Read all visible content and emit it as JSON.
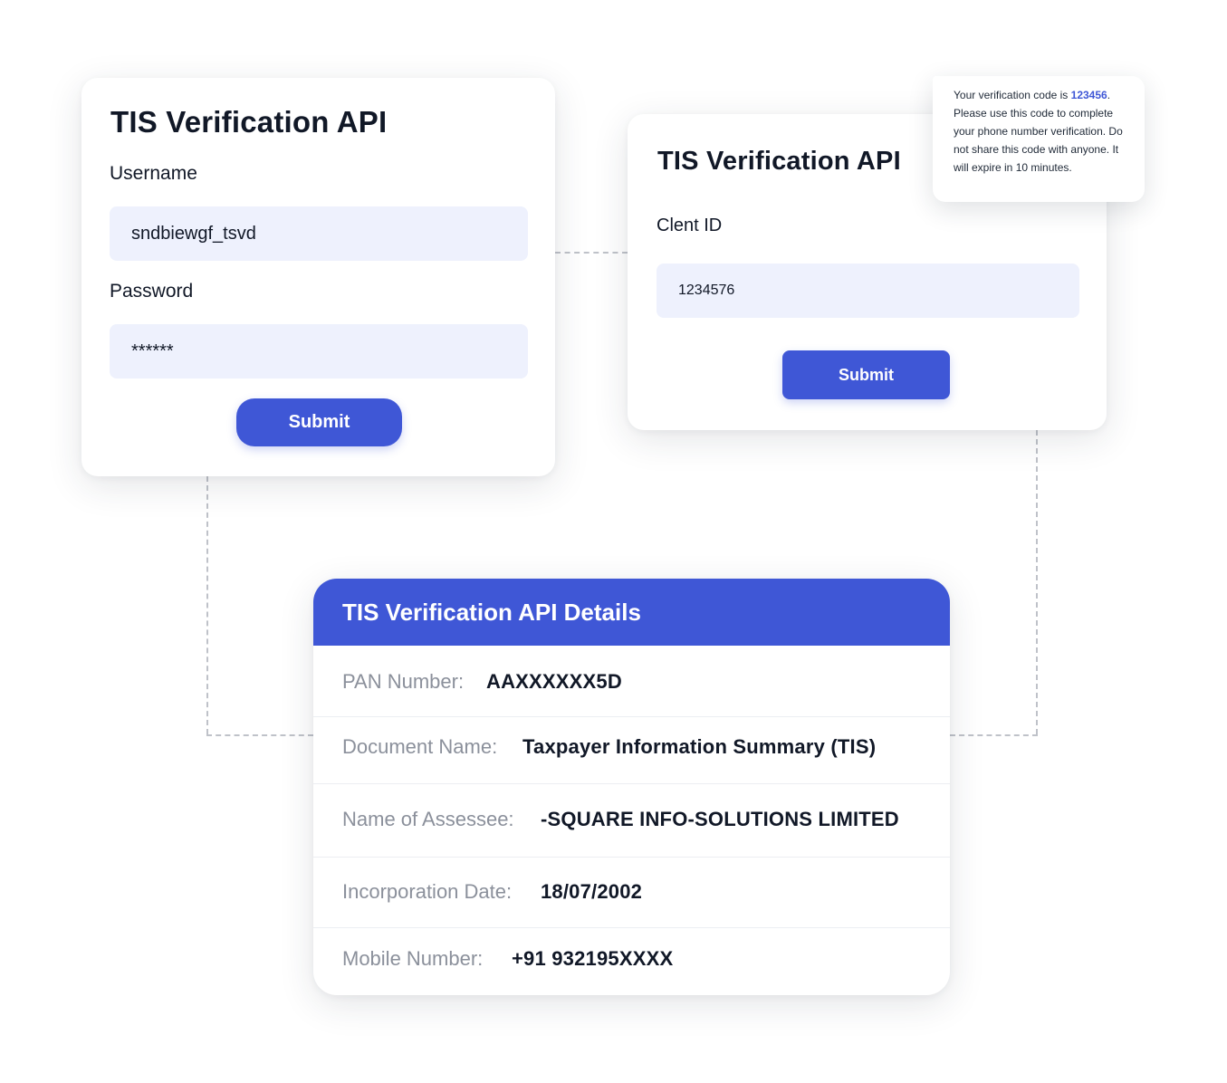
{
  "login_card": {
    "title": "TIS Verification API",
    "username_label": "Username",
    "username_value": "sndbiewgf_tsvd",
    "password_label": "Password",
    "password_value": "******",
    "submit_label": "Submit"
  },
  "client_card": {
    "title": "TIS Verification API",
    "client_id_label": "Clent ID",
    "client_id_value": "1234576",
    "submit_label": "Submit"
  },
  "sms": {
    "prefix": "Your verification code is ",
    "code": "123456",
    "suffix": ". Please use this code to complete your phone number verification. Do not share this code with anyone. It will expire in 10 minutes."
  },
  "details_card": {
    "title": "TIS Verification API Details",
    "rows": [
      {
        "label": "PAN Number:",
        "value": "AAXXXXXX5D"
      },
      {
        "label": "Document Name:",
        "value": "Taxpayer Information Summary (TIS)"
      },
      {
        "label": "Name of Assessee:",
        "value": "-SQUARE INFO-SOLUTIONS LIMITED"
      },
      {
        "label": "Incorporation Date:",
        "value": "18/07/2002"
      },
      {
        "label": "Mobile Number:",
        "value": "+91 932195XXXX"
      }
    ]
  },
  "colors": {
    "accent": "#3f57d6",
    "input_bg": "#eef1fd",
    "muted_label": "#8b909b"
  }
}
